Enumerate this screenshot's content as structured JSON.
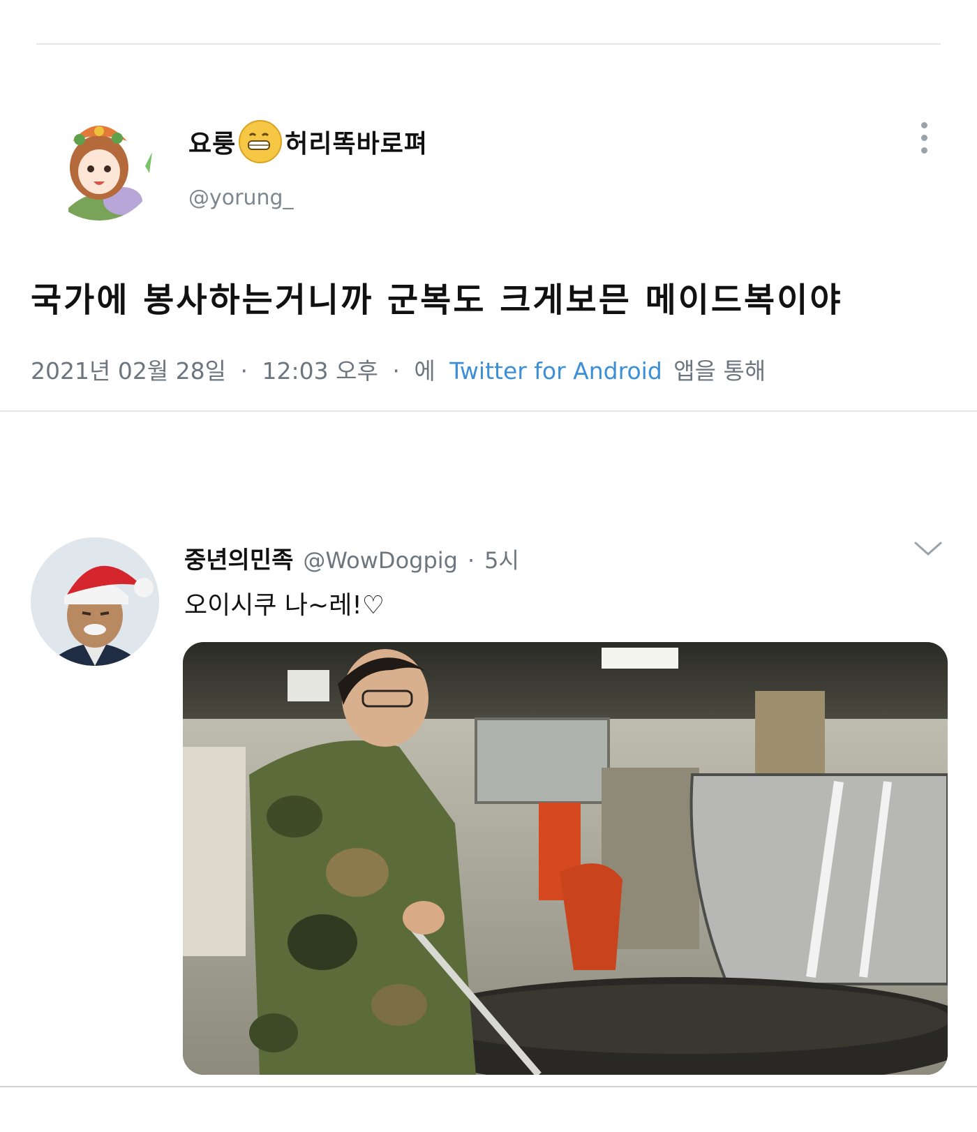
{
  "tweet1": {
    "display_name_before": "요룽",
    "display_name_after": "허리똑바로펴",
    "emoji": "grimacing-face-icon",
    "handle": "@yorung_",
    "text": "국가에 봉사하는거니까 군복도 크게보믄 메이드복이야",
    "date": "2021년 02월 28일",
    "time": "12:03 오후",
    "source_prefix": "에",
    "source": "Twitter for Android",
    "source_suffix": "앱을 통해",
    "separator": "·"
  },
  "tweet2": {
    "display_name": "중년의민족",
    "handle": "@WowDogpig",
    "separator": "·",
    "time": "5시",
    "text": "오이시쿠 나~레!♡"
  },
  "colors": {
    "link": "#3b8fd6",
    "muted": "#6d767e",
    "divider": "#e3e5e8"
  }
}
